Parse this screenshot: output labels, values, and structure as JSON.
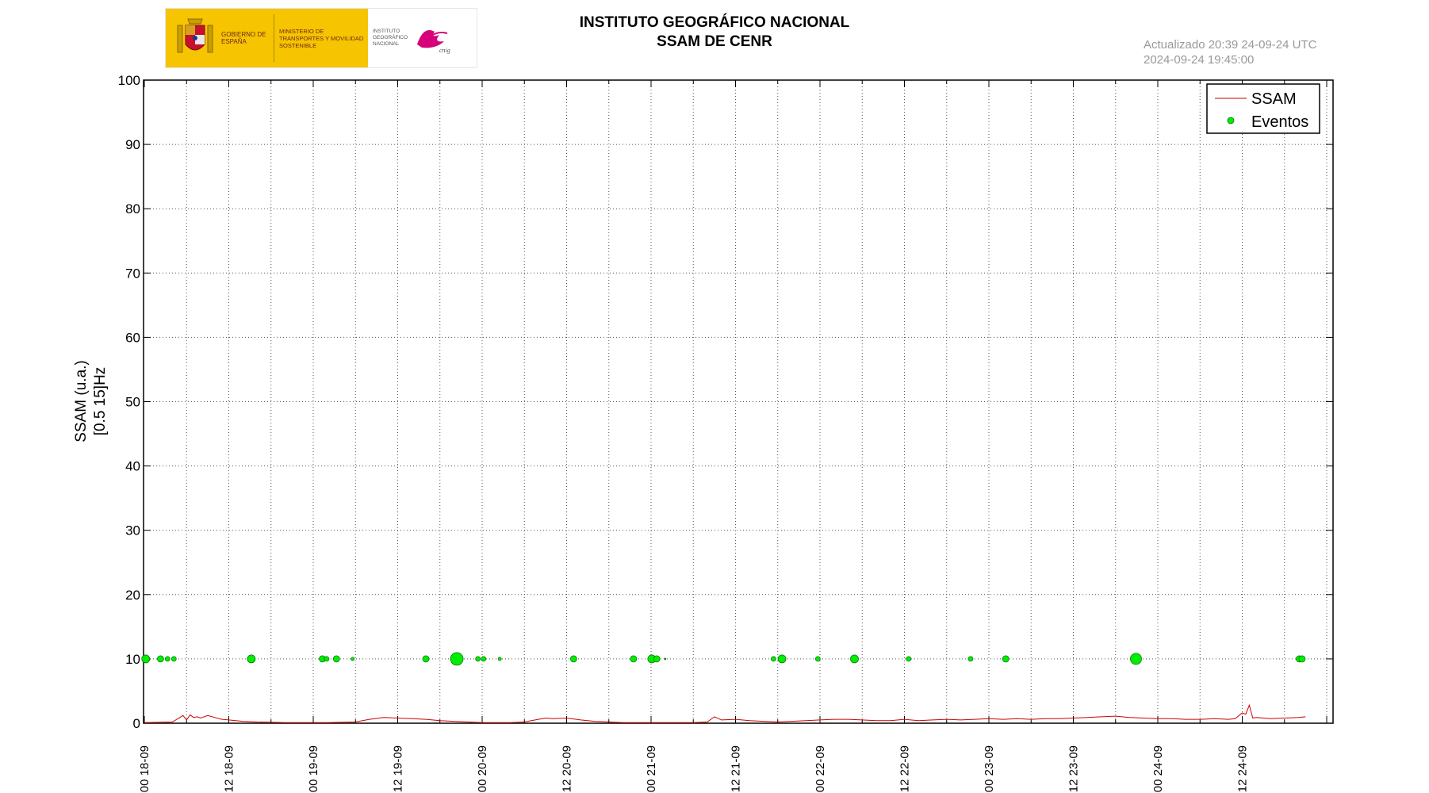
{
  "header": {
    "logo_gov": "Gobierno de España",
    "logo_ministry": "Ministerio de Transportes y Movilidad Sostenible",
    "logo_ign": "Instituto Geográfico Nacional",
    "title": "INSTITUTO GEOGRÁFICO NACIONAL",
    "subtitle": "SSAM DE CENR",
    "updated": "Actualizado 20:39 24-09-24 UTC",
    "data_time": "2024-09-24 19:45:00"
  },
  "colors": {
    "ssam": "#cc0000",
    "events_fill": "#00ee00",
    "events_stroke": "#007700",
    "grid": "#555555",
    "stamp": "#999999"
  },
  "chart_data": {
    "type": "line",
    "title": "SSAM DE CENR",
    "ylabel_lines": [
      "SSAM (u.a.)",
      "[0.5 15]Hz"
    ],
    "xlabel": "",
    "ylim": [
      0,
      100
    ],
    "xlim_hours": [
      0,
      170
    ],
    "y_ticks": [
      0,
      10,
      20,
      30,
      40,
      50,
      60,
      70,
      80,
      90,
      100
    ],
    "x_tick_labels": [
      "00 18-09",
      "12 18-09",
      "00 19-09",
      "12 19-09",
      "00 20-09",
      "12 20-09",
      "00 21-09",
      "12 21-09",
      "00 22-09",
      "12 22-09",
      "00 23-09",
      "12 23-09",
      "00 24-09",
      "12 24-09"
    ],
    "legend": {
      "position": "top-right",
      "entries": [
        "SSAM",
        "Eventos"
      ]
    },
    "grid": true,
    "series": [
      {
        "name": "SSAM",
        "kind": "line",
        "x": [
          0,
          4,
          5.5,
          6,
          6.5,
          7,
          7.5,
          8,
          9,
          10,
          11,
          12,
          14,
          16,
          20,
          24,
          26,
          30,
          32,
          34,
          36,
          38,
          40,
          42,
          44,
          46,
          48,
          50,
          52,
          54,
          56,
          57,
          58,
          60,
          62,
          64,
          66,
          68,
          70,
          72,
          74,
          76,
          78,
          80,
          81,
          82,
          84,
          86,
          88,
          90,
          92,
          94,
          96,
          98,
          100,
          102,
          104,
          106,
          108,
          110,
          112,
          114,
          116,
          118,
          120,
          122,
          124,
          126,
          128,
          130,
          132,
          134,
          136,
          138,
          140,
          142,
          144,
          146,
          148,
          150,
          152,
          154,
          155,
          156,
          156.5,
          157,
          157.5,
          158,
          160,
          162,
          164,
          165
        ],
        "values": [
          0.1,
          0.2,
          1.2,
          0.5,
          1.3,
          0.9,
          1.0,
          0.8,
          1.2,
          0.9,
          0.6,
          0.5,
          0.3,
          0.2,
          0.1,
          0.1,
          0.1,
          0.2,
          0.6,
          0.9,
          0.8,
          0.7,
          0.6,
          0.4,
          0.3,
          0.2,
          0.1,
          0.1,
          0.1,
          0.2,
          0.6,
          0.8,
          0.7,
          0.8,
          0.5,
          0.3,
          0.2,
          0.1,
          0.1,
          0.1,
          0.1,
          0.1,
          0.1,
          0.2,
          1.0,
          0.5,
          0.6,
          0.4,
          0.3,
          0.2,
          0.3,
          0.4,
          0.5,
          0.6,
          0.6,
          0.5,
          0.4,
          0.4,
          0.6,
          0.4,
          0.5,
          0.6,
          0.5,
          0.6,
          0.7,
          0.6,
          0.7,
          0.6,
          0.7,
          0.7,
          0.8,
          0.9,
          1.0,
          1.1,
          0.9,
          0.8,
          0.7,
          0.7,
          0.6,
          0.6,
          0.7,
          0.6,
          0.7,
          1.6,
          1.4,
          2.8,
          0.8,
          0.9,
          0.7,
          0.8,
          0.9,
          1.0
        ]
      },
      {
        "name": "Eventos",
        "kind": "scatter",
        "x": [
          0.2,
          2.3,
          3.3,
          4.2,
          15.2,
          25.3,
          25.9,
          27.3,
          29.6,
          40.0,
          44.4,
          47.4,
          48.2,
          50.5,
          61.0,
          69.5,
          72.1,
          72.8,
          74.0,
          89.4,
          90.6,
          95.7,
          100.9,
          108.6,
          117.4,
          122.4,
          140.9,
          164.1,
          164.5
        ],
        "values": [
          10,
          10,
          10,
          10,
          10,
          10,
          10,
          10,
          10,
          10,
          10,
          10,
          10,
          10,
          10,
          10,
          10,
          10,
          10,
          10,
          10,
          10,
          10,
          10,
          10,
          10,
          10,
          10,
          10
        ],
        "sizes": [
          5,
          4,
          3,
          3,
          5,
          4,
          3,
          4,
          2,
          4,
          8,
          3,
          3,
          2,
          4,
          4,
          5,
          4,
          1,
          3,
          5,
          3,
          5,
          3,
          3,
          4,
          7,
          4,
          4
        ]
      }
    ]
  }
}
